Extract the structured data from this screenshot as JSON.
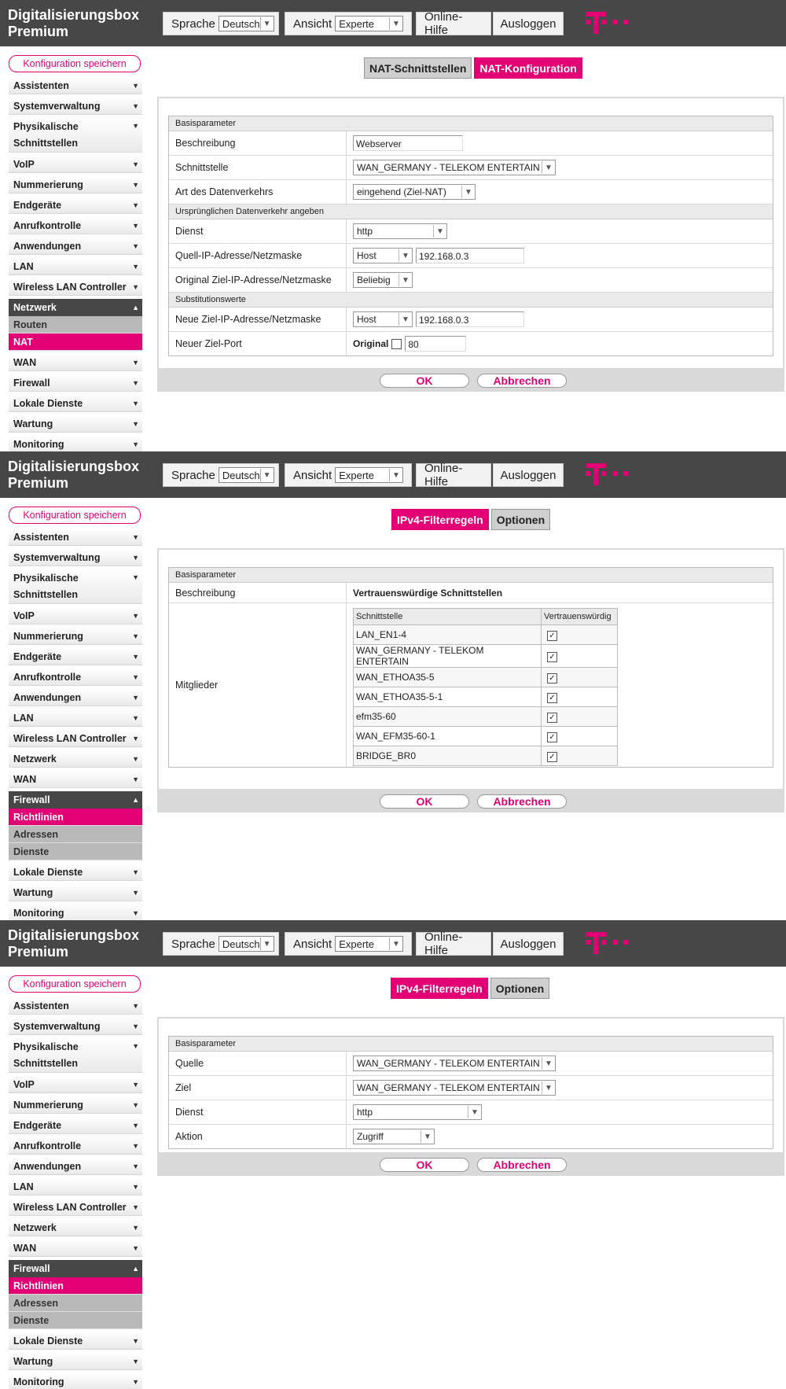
{
  "header": {
    "brand_line1": "Digitalisierungsbox",
    "brand_line2": "Premium",
    "language_label": "Sprache",
    "language_value": "Deutsch",
    "view_label": "Ansicht",
    "view_value": "Experte",
    "help_label": "Online-Hilfe",
    "logout_label": "Ausloggen"
  },
  "colors": {
    "accent": "#e20074",
    "header_bg": "#474747",
    "tab_inactive": "#cfcfcf"
  },
  "sidebar": {
    "save_label": "Konfiguration speichern",
    "items": {
      "assistenten": "Assistenten",
      "systemverwaltung": "Systemverwaltung",
      "physikalische_1": "Physikalische",
      "physikalische_2": "Schnittstellen",
      "voip": "VoIP",
      "nummerierung": "Nummerierung",
      "endgeraete": "Endgeräte",
      "anrufkontrolle": "Anrufkontrolle",
      "anwendungen": "Anwendungen",
      "lan": "LAN",
      "wlan": "Wireless LAN Controller",
      "netzwerk": "Netzwerk",
      "routen": "Routen",
      "nat": "NAT",
      "wan": "WAN",
      "firewall": "Firewall",
      "richtlinien": "Richtlinien",
      "adressen": "Adressen",
      "dienste": "Dienste",
      "lokale_dienste": "Lokale Dienste",
      "wartung": "Wartung",
      "monitoring": "Monitoring"
    }
  },
  "buttons": {
    "ok": "OK",
    "cancel": "Abbrechen"
  },
  "nat": {
    "tab_interfaces": "NAT-Schnittstellen",
    "tab_config": "NAT-Konfiguration",
    "sec_basic": "Basisparameter",
    "beschreibung_label": "Beschreibung",
    "beschreibung_value": "Webserver",
    "schnittstelle_label": "Schnittstelle",
    "schnittstelle_value": "WAN_GERMANY - TELEKOM ENTERTAIN",
    "art_label": "Art des Datenverkehrs",
    "art_value": "eingehend (Ziel-NAT)",
    "sec_original": "Ursprünglichen Datenverkehr angeben",
    "dienst_label": "Dienst",
    "dienst_value": "http",
    "quell_label": "Quell-IP-Adresse/Netzmaske",
    "quell_type": "Host",
    "quell_ip": "192.168.0.3",
    "origziel_label": "Original Ziel-IP-Adresse/Netzmaske",
    "origziel_value": "Beliebig",
    "sec_subst": "Substitutionswerte",
    "neuziel_label": "Neue Ziel-IP-Adresse/Netzmaske",
    "neuziel_type": "Host",
    "neuziel_ip": "192.168.0.3",
    "port_label": "Neuer Ziel-Port",
    "port_original_label": "Original",
    "port_value": "80"
  },
  "fw_group": {
    "tab_rules": "IPv4-Filterregeln",
    "tab_options": "Optionen",
    "sec_basic": "Basisparameter",
    "beschreibung_label": "Beschreibung",
    "beschreibung_value": "Vertrauenswürdige Schnittstellen",
    "mitglieder_label": "Mitglieder",
    "col_interface": "Schnittstelle",
    "col_trusted": "Vertrauenswürdig",
    "members": [
      "LAN_EN1-4",
      "WAN_GERMANY - TELEKOM ENTERTAIN",
      "WAN_ETHOA35-5",
      "WAN_ETHOA35-5-1",
      "efm35-60",
      "WAN_EFM35-60-1",
      "BRIDGE_BR0"
    ]
  },
  "fw_rule": {
    "tab_rules": "IPv4-Filterregeln",
    "tab_options": "Optionen",
    "sec_basic": "Basisparameter",
    "quelle_label": "Quelle",
    "quelle_value": "WAN_GERMANY - TELEKOM ENTERTAIN",
    "ziel_label": "Ziel",
    "ziel_value": "WAN_GERMANY - TELEKOM ENTERTAIN",
    "dienst_label": "Dienst",
    "dienst_value": "http",
    "aktion_label": "Aktion",
    "aktion_value": "Zugriff"
  }
}
